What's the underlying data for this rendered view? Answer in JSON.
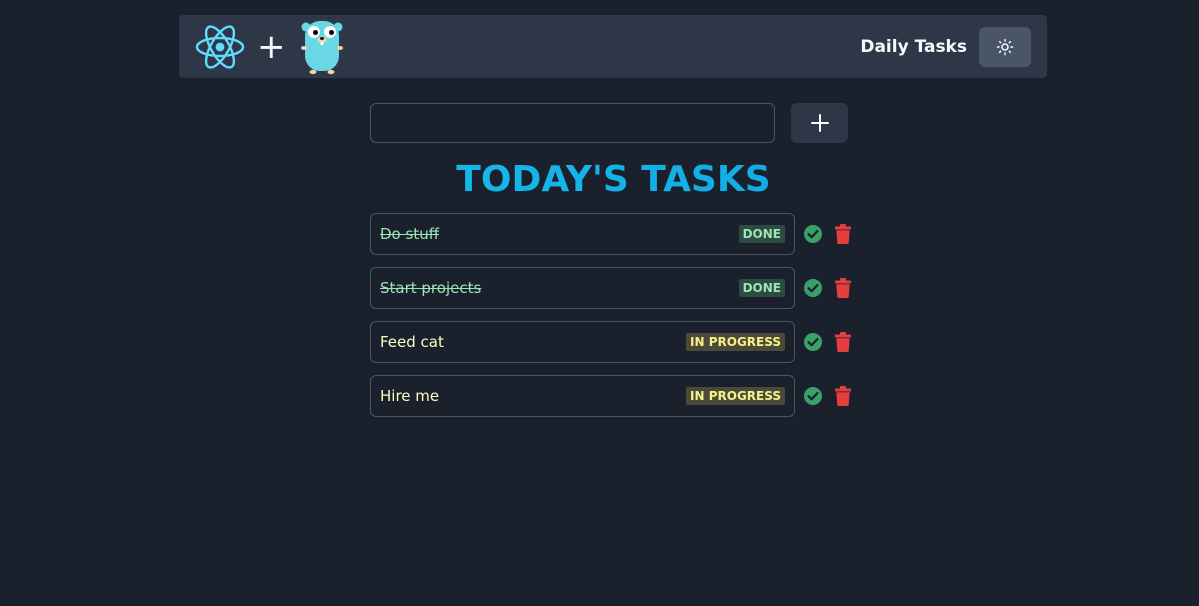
{
  "navbar": {
    "title": "Daily Tasks",
    "plus": "+",
    "logos": [
      "react-icon",
      "gopher-icon"
    ],
    "theme_toggle_icon": "sun-icon"
  },
  "add_task": {
    "input_value": "",
    "input_placeholder": "",
    "add_icon": "plus-icon"
  },
  "heading": "TODAY'S TASKS",
  "tasks": [
    {
      "text": "Do stuff",
      "status": "DONE",
      "done": true
    },
    {
      "text": "Start projects",
      "status": "DONE",
      "done": true
    },
    {
      "text": "Feed cat",
      "status": "IN PROGRESS",
      "done": false
    },
    {
      "text": "Hire me",
      "status": "IN PROGRESS",
      "done": false
    }
  ],
  "colors": {
    "background": "#1a202c",
    "navbar": "#2d3748",
    "heading": "#18b5e8",
    "done_text": "#9ae6b4",
    "progress_text": "#fefcbf",
    "check": "#38a169",
    "trash": "#e53e3e"
  }
}
